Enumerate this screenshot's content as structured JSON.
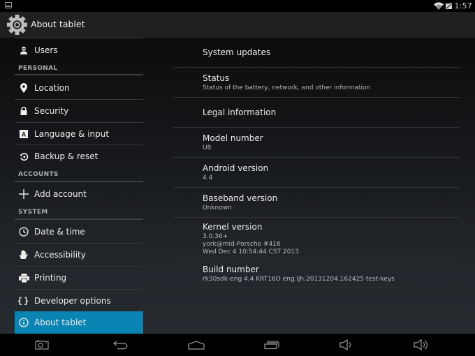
{
  "status_bar": {
    "time": "1:57",
    "left_icon": "screenshot-notification-icon",
    "right_icons": [
      "wifi-icon",
      "signal-icon"
    ]
  },
  "action_bar": {
    "icon": "settings-gear-icon",
    "title": "About tablet"
  },
  "sidebar": {
    "items": [
      {
        "type": "item",
        "label": "Users",
        "icon": "user-icon"
      },
      {
        "type": "header",
        "label": "PERSONAL"
      },
      {
        "type": "item",
        "label": "Location",
        "icon": "location-pin-icon"
      },
      {
        "type": "item",
        "label": "Security",
        "icon": "lock-icon"
      },
      {
        "type": "item",
        "label": "Language & input",
        "icon": "language-icon"
      },
      {
        "type": "item",
        "label": "Backup & reset",
        "icon": "backup-restore-icon"
      },
      {
        "type": "header",
        "label": "ACCOUNTS"
      },
      {
        "type": "item",
        "label": "Add account",
        "icon": "plus-icon"
      },
      {
        "type": "header",
        "label": "SYSTEM"
      },
      {
        "type": "item",
        "label": "Date & time",
        "icon": "clock-icon"
      },
      {
        "type": "item",
        "label": "Accessibility",
        "icon": "hand-icon"
      },
      {
        "type": "item",
        "label": "Printing",
        "icon": "printer-icon"
      },
      {
        "type": "item",
        "label": "Developer options",
        "icon": "braces-icon"
      },
      {
        "type": "item",
        "label": "About tablet",
        "icon": "info-icon",
        "selected": true
      }
    ],
    "selected_color": "#0a84b2"
  },
  "main": {
    "prefs": [
      {
        "title": "System updates",
        "summary": ""
      },
      {
        "title": "Status",
        "summary": "Status of the battery, network, and other information"
      },
      {
        "title": "Legal information",
        "summary": ""
      },
      {
        "title": "Model number",
        "summary": "U8"
      },
      {
        "title": "Android version",
        "summary": "4.4"
      },
      {
        "title": "Baseband version",
        "summary": "Unknown"
      },
      {
        "title": "Kernel version",
        "summary": "3.0.36+\nyork@mid-Porsche #416\nWed Dec 4 10:54:44 CST 2013"
      },
      {
        "title": "Build number",
        "summary": "rk30sdk-eng 4.4 KRT16O eng.ljh.20131204.162425 test-keys"
      }
    ]
  },
  "nav_bar": {
    "buttons": [
      {
        "name": "screenshot-button",
        "icon": "camera-icon"
      },
      {
        "name": "back-button",
        "icon": "back-arrow-icon"
      },
      {
        "name": "home-button",
        "icon": "home-icon"
      },
      {
        "name": "recent-apps-button",
        "icon": "recent-apps-icon"
      },
      {
        "name": "volume-down-button",
        "icon": "volume-down-icon"
      },
      {
        "name": "volume-up-button",
        "icon": "volume-up-icon"
      }
    ]
  }
}
